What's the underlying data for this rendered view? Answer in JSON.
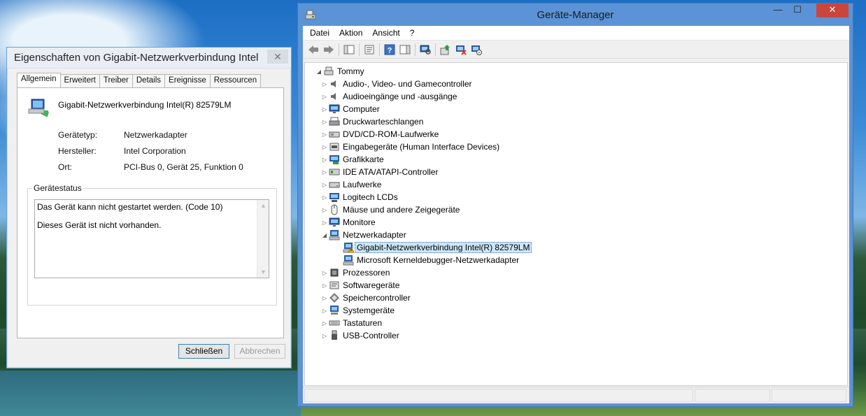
{
  "properties_dialog": {
    "title": "Eigenschaften von Gigabit-Netzwerkverbindung Intel(...",
    "close_label": "✕",
    "tabs": [
      "Allgemein",
      "Erweitert",
      "Treiber",
      "Details",
      "Ereignisse",
      "Ressourcen"
    ],
    "active_tab": "Allgemein",
    "device_name": "Gigabit-Netzwerkverbindung Intel(R) 82579LM",
    "properties": [
      {
        "label": "Gerätetyp:",
        "value": "Netzwerkadapter"
      },
      {
        "label": "Hersteller:",
        "value": "Intel Corporation"
      },
      {
        "label": "Ort:",
        "value": "PCI-Bus 0, Gerät 25, Funktion 0"
      }
    ],
    "status_group_label": "Gerätestatus",
    "status_lines": [
      "Das Gerät kann nicht gestartet werden. (Code 10)",
      "Dieses Gerät ist nicht vorhanden."
    ],
    "buttons": {
      "close": "Schließen",
      "cancel": "Abbrechen"
    }
  },
  "device_manager": {
    "title": "Geräte-Manager",
    "window_controls": {
      "minimize": "—",
      "maximize": "☐",
      "close": "✕"
    },
    "menu": [
      "Datei",
      "Aktion",
      "Ansicht",
      "?"
    ],
    "toolbar_icons": [
      "back-icon",
      "forward-icon",
      "show-hide-console-tree-icon",
      "properties-icon",
      "help-icon",
      "action-pane-icon",
      "scan-hardware-icon",
      "update-driver-icon",
      "disable-device-icon",
      "uninstall-device-icon"
    ],
    "tree": {
      "root": "Tommy",
      "categories": [
        {
          "label": "Audio-, Video- und Gamecontroller",
          "icon": "speaker-icon",
          "expanded": false
        },
        {
          "label": "Audioeingänge und -ausgänge",
          "icon": "speaker-icon",
          "expanded": false
        },
        {
          "label": "Computer",
          "icon": "monitor-icon",
          "expanded": false
        },
        {
          "label": "Druckwarteschlangen",
          "icon": "printer-icon",
          "expanded": false
        },
        {
          "label": "DVD/CD-ROM-Laufwerke",
          "icon": "optical-drive-icon",
          "expanded": false
        },
        {
          "label": "Eingabegeräte (Human Interface Devices)",
          "icon": "hid-icon",
          "expanded": false
        },
        {
          "label": "Grafikkarte",
          "icon": "display-adapter-icon",
          "expanded": false
        },
        {
          "label": "IDE ATA/ATAPI-Controller",
          "icon": "ide-controller-icon",
          "expanded": false
        },
        {
          "label": "Laufwerke",
          "icon": "disk-drive-icon",
          "expanded": false
        },
        {
          "label": "Logitech LCDs",
          "icon": "lcd-icon",
          "expanded": false
        },
        {
          "label": "Mäuse und andere Zeigegeräte",
          "icon": "mouse-icon",
          "expanded": false
        },
        {
          "label": "Monitore",
          "icon": "monitor-icon",
          "expanded": false
        },
        {
          "label": "Netzwerkadapter",
          "icon": "network-adapter-icon",
          "expanded": true,
          "children": [
            {
              "label": "Gigabit-Netzwerkverbindung Intel(R) 82579LM",
              "icon": "network-adapter-warning-icon",
              "selected": true
            },
            {
              "label": "Microsoft Kerneldebugger-Netzwerkadapter",
              "icon": "network-adapter-icon",
              "selected": false
            }
          ]
        },
        {
          "label": "Prozessoren",
          "icon": "processor-icon",
          "expanded": false
        },
        {
          "label": "Softwaregeräte",
          "icon": "software-device-icon",
          "expanded": false
        },
        {
          "label": "Speichercontroller",
          "icon": "storage-controller-icon",
          "expanded": false
        },
        {
          "label": "Systemgeräte",
          "icon": "system-device-icon",
          "expanded": false
        },
        {
          "label": "Tastaturen",
          "icon": "keyboard-icon",
          "expanded": false
        },
        {
          "label": "USB-Controller",
          "icon": "usb-icon",
          "expanded": false
        }
      ]
    }
  }
}
